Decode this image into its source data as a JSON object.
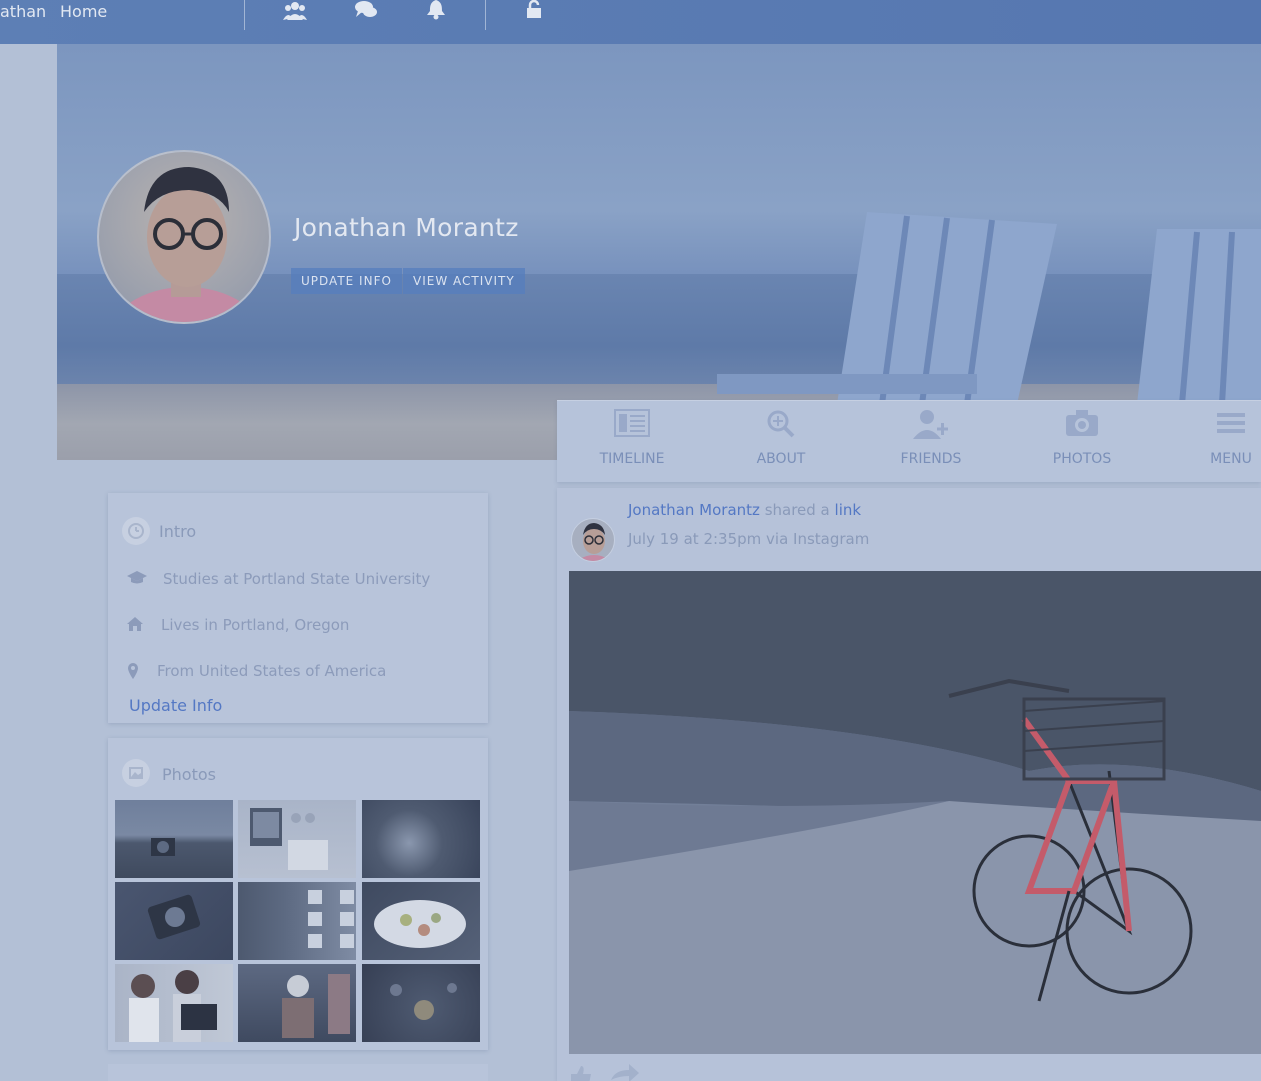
{
  "topnav": {
    "user_name": "athan",
    "home_label": "Home",
    "icons": [
      "friends-icon",
      "messages-icon",
      "notifications-icon",
      "privacy-lock-icon"
    ]
  },
  "profile": {
    "name": "Jonathan Morantz",
    "update_info_label": "UPDATE INFO",
    "view_activity_label": "VIEW ACTIVITY"
  },
  "tabs": [
    {
      "label": "TIMELINE",
      "icon": "timeline-icon"
    },
    {
      "label": "ABOUT",
      "icon": "about-search-icon"
    },
    {
      "label": "FRIENDS",
      "icon": "add-friend-icon"
    },
    {
      "label": "PHOTOS",
      "icon": "camera-icon"
    },
    {
      "label": "MENU",
      "icon": "menu-icon"
    }
  ],
  "intro": {
    "title": "Intro",
    "rows": [
      {
        "icon": "graduation-cap-icon",
        "text": "Studies at Portland State University"
      },
      {
        "icon": "home-icon",
        "text": "Lives in Portland, Oregon"
      },
      {
        "icon": "map-pin-icon",
        "text": "From United States of America"
      }
    ],
    "update_link": "Update Info"
  },
  "photos": {
    "title": "Photos",
    "thumbnails": [
      "camera-on-field",
      "laptop-desk",
      "dark-tech",
      "vintage-camera",
      "building-facade",
      "food-plate",
      "girls-laptop",
      "street-photographer",
      "coffee-table"
    ]
  },
  "post": {
    "author": "Jonathan Morantz",
    "action_text": "shared a",
    "link_text": "link",
    "meta": "July 19 at 2:35pm via Instagram",
    "image": "red bicycle on path"
  },
  "colors": {
    "nav": "#5677b0",
    "link": "#5478c4",
    "overlay_tint": "#b3c0d6"
  }
}
